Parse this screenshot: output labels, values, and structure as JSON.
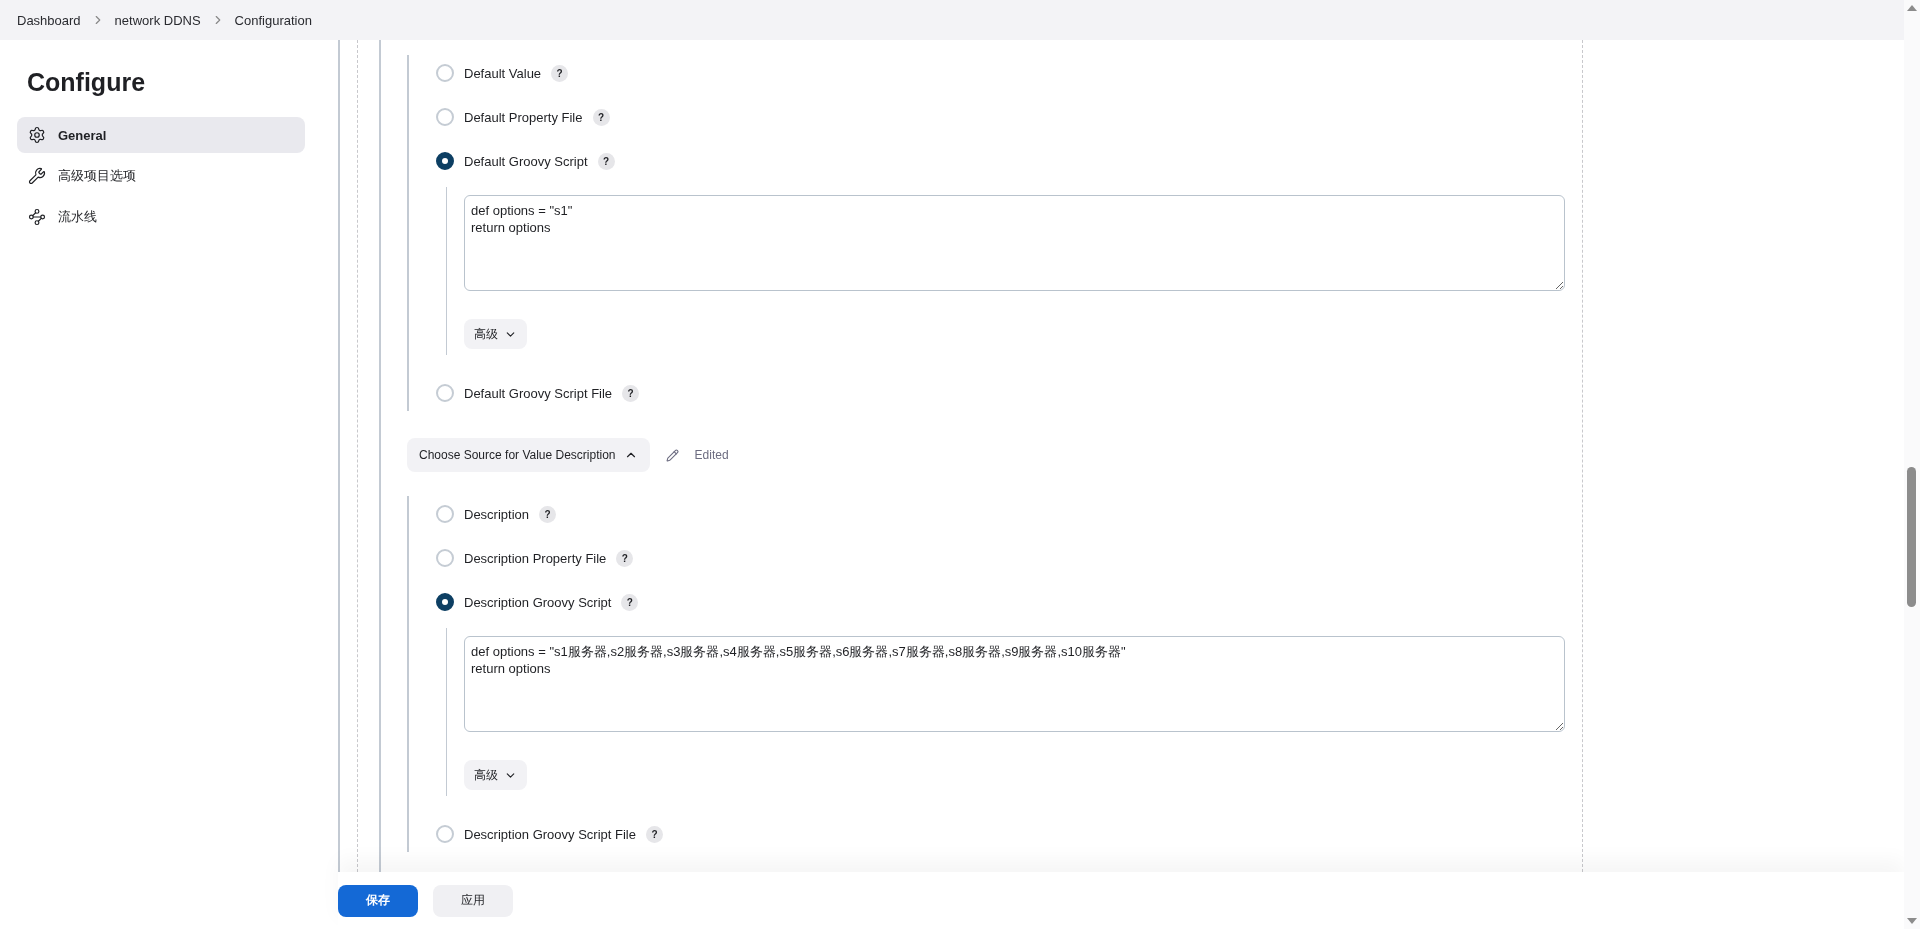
{
  "breadcrumbs": [
    "Dashboard",
    "network DDNS",
    "Configuration"
  ],
  "sidebar": {
    "title": "Configure",
    "items": [
      {
        "label": "General",
        "selected": true
      },
      {
        "label": "高级项目选项",
        "selected": false
      },
      {
        "label": "流水线",
        "selected": false
      }
    ]
  },
  "sections": [
    {
      "options": [
        {
          "label": "Default Value",
          "help": "?",
          "selected": false
        },
        {
          "label": "Default Property File",
          "help": "?",
          "selected": false
        },
        {
          "label": "Default Groovy Script",
          "help": "?",
          "selected": true,
          "script": "def options = \"s1\"\nreturn options",
          "advanced": "高级"
        },
        {
          "label": "Default Groovy Script File",
          "help": "?",
          "selected": false
        }
      ]
    },
    {
      "header": {
        "label": "Choose Source for Value Description",
        "expanded": true,
        "status": "Edited"
      },
      "options": [
        {
          "label": "Description",
          "help": "?",
          "selected": false
        },
        {
          "label": "Description Property File",
          "help": "?",
          "selected": false
        },
        {
          "label": "Description Groovy Script",
          "help": "?",
          "selected": true,
          "script": "def options = \"s1服务器,s2服务器,s3服务器,s4服务器,s5服务器,s6服务器,s7服务器,s8服务器,s9服务器,s10服务器\"\nreturn options",
          "advanced": "高级"
        },
        {
          "label": "Description Groovy Script File",
          "help": "?",
          "selected": false
        }
      ]
    }
  ],
  "footer": [
    {
      "label": "保存",
      "kind": "primary"
    },
    {
      "label": "应用",
      "kind": "secondary"
    }
  ]
}
